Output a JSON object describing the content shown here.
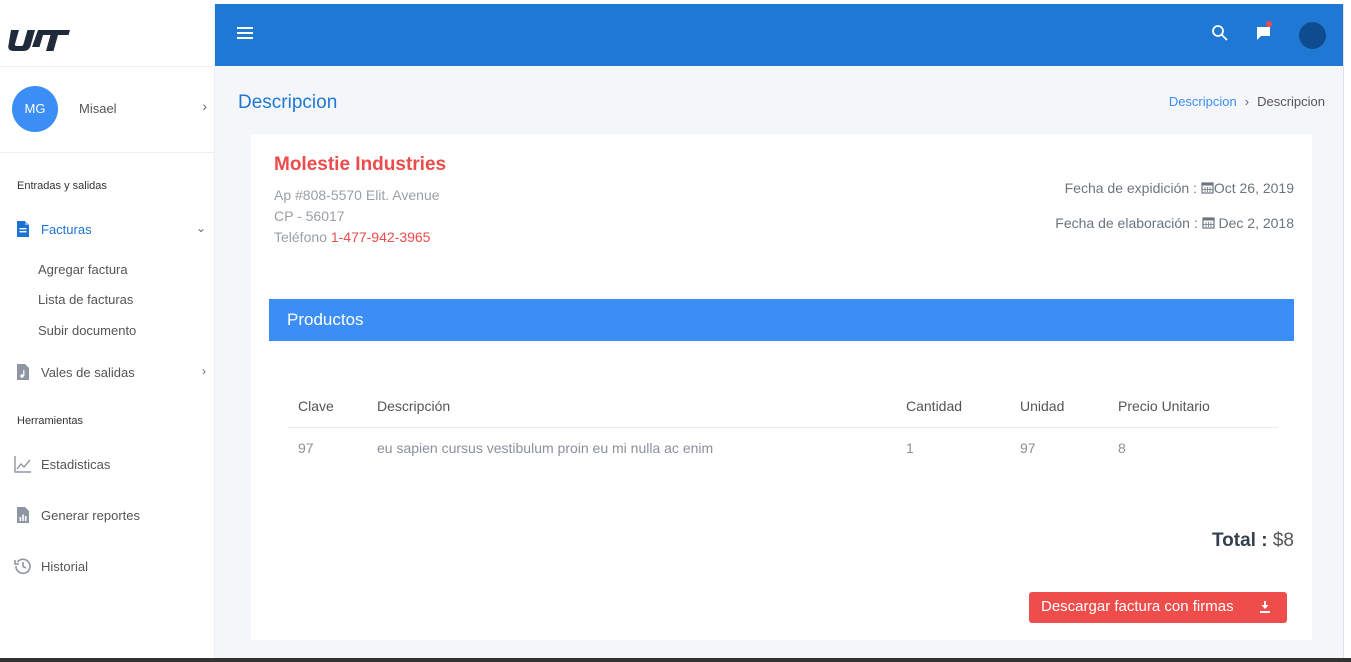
{
  "colors": {
    "primary": "#1e78d4",
    "accent": "#3a8ef6",
    "danger": "#ef4c4c",
    "sidebar_bg": "#ffffff",
    "page_bg": "#f5f6fa"
  },
  "sidebar": {
    "logo_icon": "utt-logo",
    "user": {
      "initials": "MG",
      "name": "Misael"
    },
    "sections": [
      {
        "title": "Entradas y salidas"
      },
      {
        "title": "Herramientas"
      }
    ],
    "nav": {
      "facturas": {
        "label": "Facturas",
        "icon": "document-icon",
        "expanded": true
      },
      "facturas_sub": [
        "Agregar factura",
        "Lista de facturas",
        "Subir documento"
      ],
      "vales": {
        "label": "Vales de salidas",
        "icon": "file-audio-icon"
      },
      "estadisticas": {
        "label": "Estadisticas",
        "icon": "chart-line-icon"
      },
      "reportes": {
        "label": "Generar reportes",
        "icon": "report-icon"
      },
      "historial": {
        "label": "Historial",
        "icon": "history-icon"
      }
    }
  },
  "header": {
    "menu_icon": "hamburger-icon",
    "search_icon": "search-icon",
    "chat_icon": "chat-icon",
    "has_notification": true
  },
  "page": {
    "title": "Descripcion",
    "breadcrumb": [
      "Descripcion",
      "Descripcion"
    ]
  },
  "invoice": {
    "company": "Molestie Industries",
    "address_line1": "Ap #808-5570 Elit. Avenue",
    "address_line2": "CP - 56017",
    "phone_label": "Teléfono ",
    "phone": "1-477-942-3965",
    "fecha_expidicion_label": "Fecha de expidición :",
    "fecha_expidicion": "Oct 26, 2019",
    "fecha_elaboracion_label": "Fecha de elaboración :",
    "fecha_elaboracion": " Dec 2, 2018",
    "products_title": "Productos",
    "columns": [
      "Clave",
      "Descripción",
      "Cantidad",
      "Unidad",
      "Precio Unitario"
    ],
    "rows": [
      [
        "97",
        "eu sapien cursus vestibulum proin eu mi nulla ac enim",
        "1",
        "97",
        "8"
      ]
    ],
    "total_label": "Total :",
    "total_value": " $8",
    "download_button": "Descargar factura con firmas",
    "download_icon": "download-icon"
  }
}
